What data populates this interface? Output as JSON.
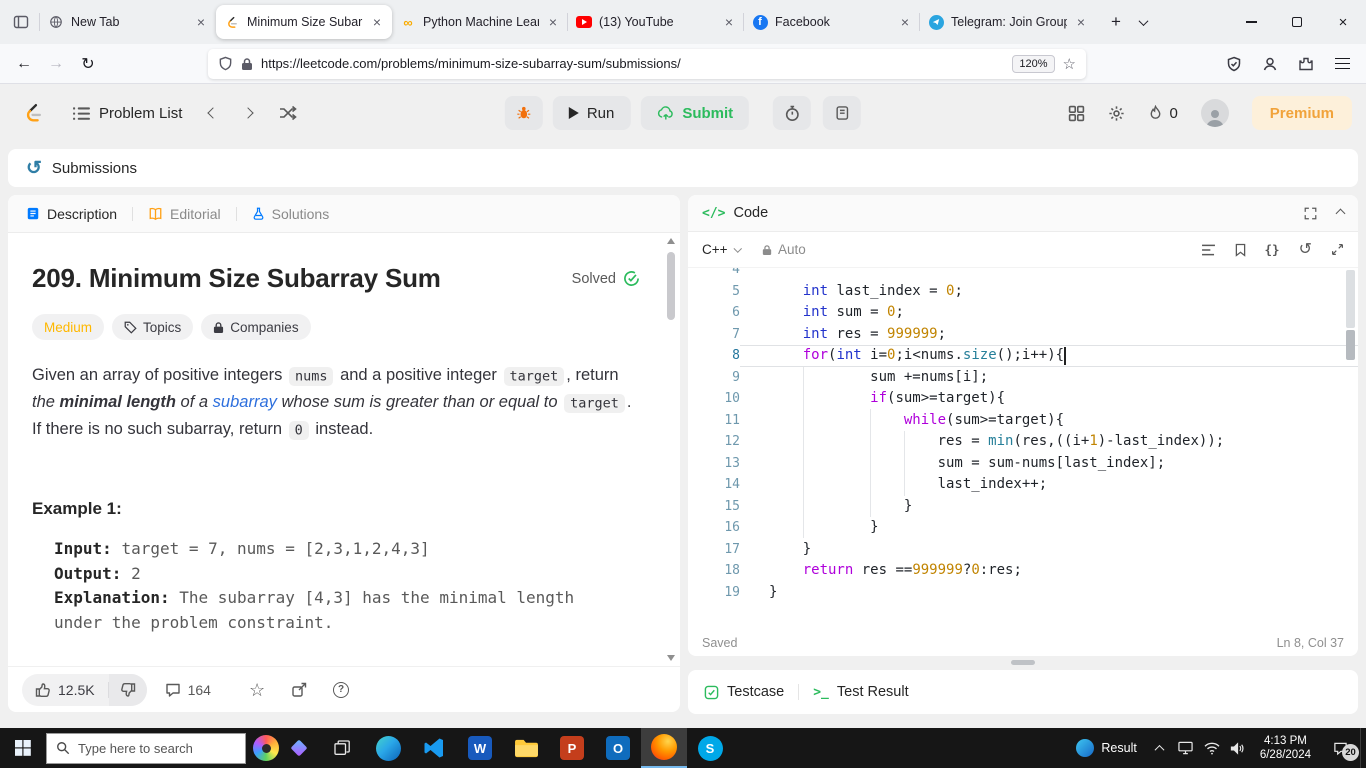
{
  "colors": {
    "leetcode_orange": "#ffa116",
    "green": "#2cbb5d",
    "blue": "#007aff",
    "medium": "#ffb800"
  },
  "browser": {
    "tabs": [
      {
        "title": "New Tab",
        "favicon": "globe-icon"
      },
      {
        "title": "Minimum Size Subarra",
        "favicon": "leetcode-icon"
      },
      {
        "title": "Python Machine Learn",
        "favicon": "colab-icon"
      },
      {
        "title": "(13) YouTube",
        "favicon": "youtube-icon"
      },
      {
        "title": "Facebook",
        "favicon": "facebook-icon"
      },
      {
        "title": "Telegram: Join Group (",
        "favicon": "telegram-icon"
      }
    ],
    "url": "https://leetcode.com/problems/minimum-size-subarray-sum/submissions/",
    "zoom": "120%"
  },
  "lc_header": {
    "problem_list": "Problem List",
    "run": "Run",
    "submit": "Submit",
    "streak": "0",
    "premium": "Premium"
  },
  "submissions_bar": {
    "label": "Submissions"
  },
  "description_panel": {
    "tabs": {
      "description": "Description",
      "editorial": "Editorial",
      "solutions": "Solutions"
    },
    "title": "209. Minimum Size Subarray Sum",
    "solved_label": "Solved",
    "difficulty": "Medium",
    "topics_label": "Topics",
    "companies_label": "Companies",
    "statement": [
      {
        "t": "Given an array of positive integers "
      },
      {
        "t": "nums",
        "c": "code"
      },
      {
        "t": " and a positive integer "
      },
      {
        "t": "target",
        "c": "code"
      },
      {
        "t": ", return "
      },
      {
        "t": "the ",
        "c": "em"
      },
      {
        "t": "minimal length",
        "c": "emb"
      },
      {
        "t": " of a ",
        "c": "em"
      },
      {
        "t": "subarray",
        "c": "link"
      },
      {
        "t": " whose sum is greater than or equal to ",
        "c": "em"
      },
      {
        "t": "target",
        "c": "code"
      },
      {
        "t": ". If there is no such subarray, return "
      },
      {
        "t": "0",
        "c": "code"
      },
      {
        "t": " instead."
      }
    ],
    "example_label": "Example 1:",
    "example": {
      "input_label": "Input: ",
      "input_value": "target = 7, nums = [2,3,1,2,4,3]",
      "output_label": "Output: ",
      "output_value": "2",
      "explanation_label": "Explanation: ",
      "explanation_value": "The subarray [4,3] has the minimal length under the problem constraint."
    },
    "footer": {
      "likes": "12.5K",
      "comments": "164"
    }
  },
  "code_panel": {
    "title": "Code",
    "language": "C++",
    "auto_label": "Auto",
    "lines": [
      {
        "n": "4",
        "s": []
      },
      {
        "n": "5",
        "s": [
          {
            "t": "    "
          },
          {
            "t": "int",
            "c": "type"
          },
          {
            "t": " last_index = "
          },
          {
            "t": "0",
            "c": "num"
          },
          {
            "t": ";"
          }
        ]
      },
      {
        "n": "6",
        "s": [
          {
            "t": "    "
          },
          {
            "t": "int",
            "c": "type"
          },
          {
            "t": " sum = "
          },
          {
            "t": "0",
            "c": "num"
          },
          {
            "t": ";"
          }
        ]
      },
      {
        "n": "7",
        "s": [
          {
            "t": "    "
          },
          {
            "t": "int",
            "c": "type"
          },
          {
            "t": " res = "
          },
          {
            "t": "999999",
            "c": "num"
          },
          {
            "t": ";"
          }
        ]
      },
      {
        "n": "8",
        "cur": true,
        "s": [
          {
            "t": "    "
          },
          {
            "t": "for",
            "c": "ctrl"
          },
          {
            "t": "("
          },
          {
            "t": "int",
            "c": "type"
          },
          {
            "t": " i="
          },
          {
            "t": "0",
            "c": "num"
          },
          {
            "t": ";i<nums."
          },
          {
            "t": "size",
            "c": "fn"
          },
          {
            "t": "();i++){"
          }
        ]
      },
      {
        "n": "9",
        "s": [
          {
            "t": "            sum +=nums[i];"
          }
        ]
      },
      {
        "n": "10",
        "s": [
          {
            "t": "            "
          },
          {
            "t": "if",
            "c": "ctrl"
          },
          {
            "t": "(sum>=target){"
          }
        ]
      },
      {
        "n": "11",
        "s": [
          {
            "t": "                "
          },
          {
            "t": "while",
            "c": "ctrl"
          },
          {
            "t": "(sum>=target){"
          }
        ]
      },
      {
        "n": "12",
        "s": [
          {
            "t": "                    res = "
          },
          {
            "t": "min",
            "c": "fn"
          },
          {
            "t": "(res,((i+"
          },
          {
            "t": "1",
            "c": "num"
          },
          {
            "t": ")-last_index));"
          }
        ]
      },
      {
        "n": "13",
        "s": [
          {
            "t": "                    sum = sum-nums[last_index];"
          }
        ]
      },
      {
        "n": "14",
        "s": [
          {
            "t": "                    last_index++;"
          }
        ]
      },
      {
        "n": "15",
        "s": [
          {
            "t": "                }"
          }
        ]
      },
      {
        "n": "16",
        "s": [
          {
            "t": "            }"
          }
        ]
      },
      {
        "n": "17",
        "s": [
          {
            "t": "    }"
          }
        ]
      },
      {
        "n": "18",
        "s": [
          {
            "t": "    "
          },
          {
            "t": "return",
            "c": "ctrl"
          },
          {
            "t": " res =="
          },
          {
            "t": "999999",
            "c": "num"
          },
          {
            "t": "?"
          },
          {
            "t": "0",
            "c": "num"
          },
          {
            "t": ":res;"
          }
        ]
      },
      {
        "n": "19",
        "s": [
          {
            "t": "}"
          }
        ]
      }
    ],
    "status": {
      "saved": "Saved",
      "cursor": "Ln 8, Col 37"
    },
    "bottom_tabs": {
      "testcase": "Testcase",
      "test_result": "Test Result"
    }
  },
  "taskbar": {
    "search_placeholder": "Type here to search",
    "widget_label": "Result",
    "time": "4:13 PM",
    "date": "6/28/2024",
    "notification_count": "20"
  }
}
